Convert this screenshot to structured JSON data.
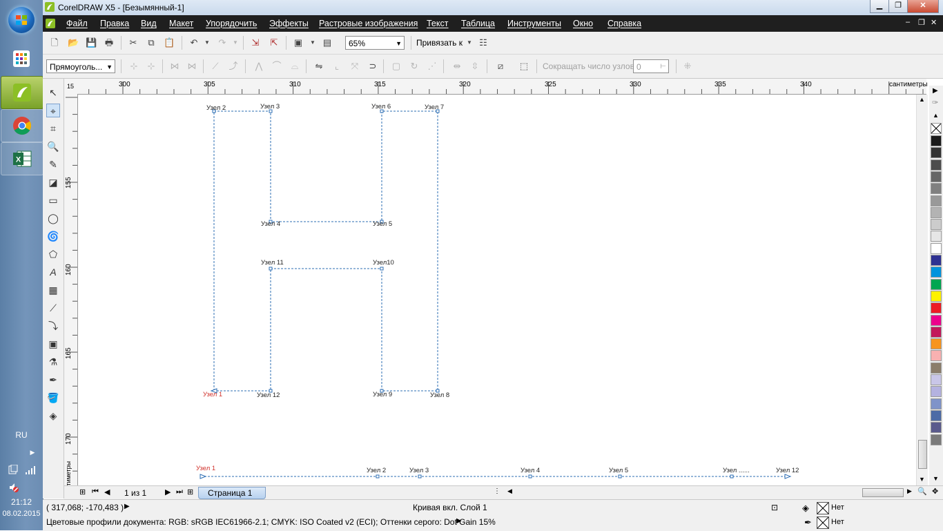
{
  "taskbar": {
    "lang": "RU",
    "time": "21:12",
    "date": "08.02.2015"
  },
  "window": {
    "title": "CorelDRAW X5 - [Безымянный-1]"
  },
  "menu": {
    "items": [
      "Файл",
      "Правка",
      "Вид",
      "Макет",
      "Упорядочить",
      "Эффекты",
      "Растровые изображения",
      "Текст",
      "Таблица",
      "Инструменты",
      "Окно",
      "Справка"
    ]
  },
  "toolbar": {
    "zoom": "65%",
    "snap_label": "Привязать к",
    "shape_combo": "Прямоуголь...",
    "reduce_nodes": "Сокращать число узлов",
    "nodes_value": "0"
  },
  "ruler": {
    "top_ticks": [
      "300",
      "305",
      "310",
      "315",
      "320",
      "325",
      "330",
      "335",
      "340"
    ],
    "units": "сантиметры",
    "left_ticks": [
      "155",
      "160",
      "165",
      "170"
    ],
    "corner": "15"
  },
  "nodes": {
    "n1": "Узел 1",
    "n2": "Узел 2",
    "n3": "Узел 3",
    "n4": "Узел 4",
    "n5": "Узел 5",
    "n6": "Узел 6",
    "n7": "Узел 7",
    "n8": "Узел 8",
    "n9": "Узел 9",
    "n10": "Узел10",
    "n11": "Узел 11",
    "n12": "Узел 12",
    "b1": "Узел 1",
    "b2": "Узел 2",
    "b3": "Узел 3",
    "b4": "Узел 4",
    "b5": "Узел 5",
    "b6": "Узел ......",
    "b12": "Узел 12"
  },
  "pagebar": {
    "page_count": "1 из 1",
    "page_tab": "Страница 1"
  },
  "status": {
    "coords": "( 317,068; -170,483 )",
    "object_info": "Кривая вкл. Слой 1",
    "color_profiles": "Цветовые профили документа: RGB: sRGB IEC61966-2.1; CMYK: ISO Coated v2 (ECI); Оттенки серого: Dot Gain 15%",
    "fill": "Нет",
    "outline": "Нет"
  },
  "colors": {
    "palette": [
      "#1a1a1a",
      "#333333",
      "#4d4d4d",
      "#666666",
      "#808080",
      "#999999",
      "#b3b3b3",
      "#cccccc",
      "#e6e6e6",
      "#ffffff",
      "#2e3192",
      "#0093dd",
      "#00a651",
      "#fff200",
      "#ed1c24",
      "#ec008c",
      "#c2185b",
      "#f7941d",
      "#f9b1b1",
      "#8b7d6b",
      "#c9c6e8",
      "#b4b2e0",
      "#7f93c9",
      "#4d6ba6",
      "#5a5a8c",
      "#7a7a7a"
    ],
    "accent": "#1b5fb4",
    "node_red": "#d0302a"
  }
}
